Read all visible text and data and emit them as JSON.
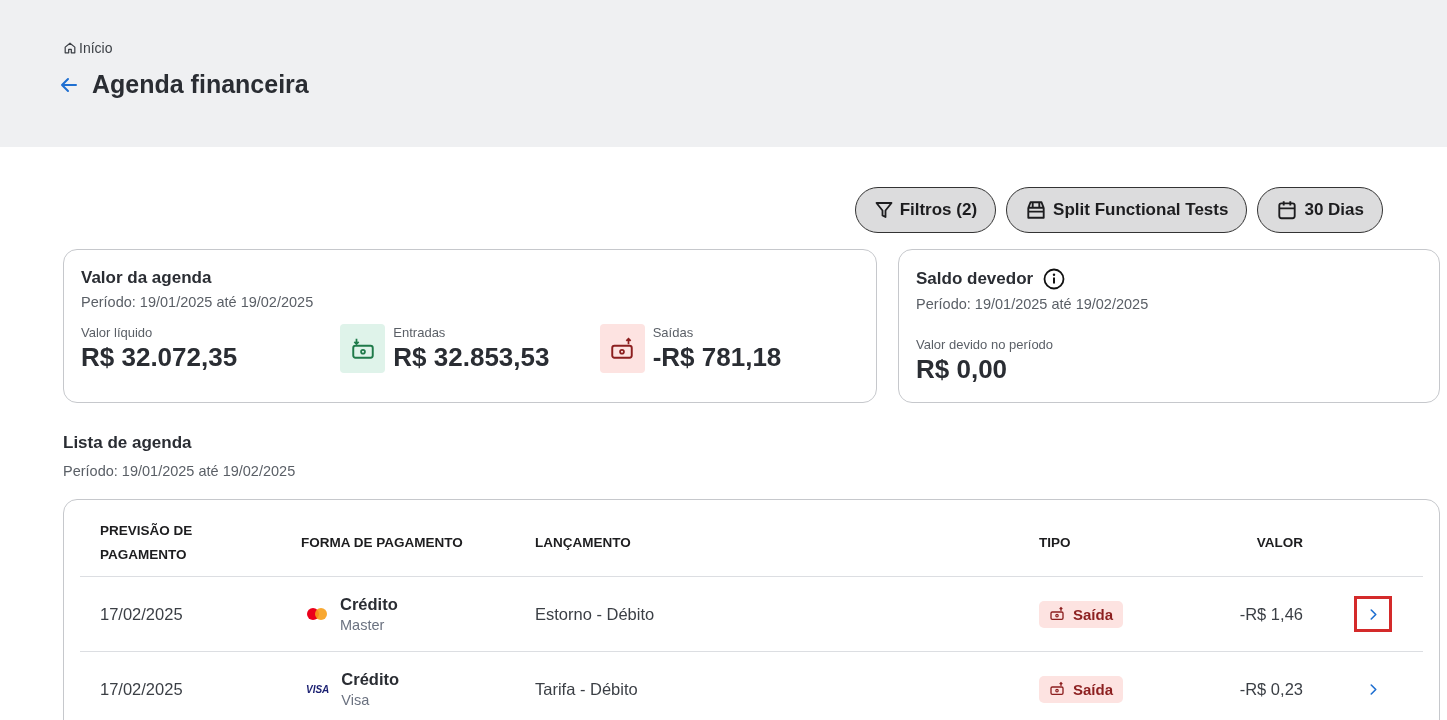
{
  "breadcrumb": {
    "label": "Início"
  },
  "page_title": "Agenda financeira",
  "toolbar": [
    {
      "kind": "filter",
      "label": "Filtros (2)"
    },
    {
      "kind": "store",
      "label": "Split Functional Tests"
    },
    {
      "kind": "calendar",
      "label": "30 Dias"
    }
  ],
  "summary_card": {
    "title": "Valor da agenda",
    "period": "Período: 19/01/2025 até 19/02/2025",
    "metrics": [
      {
        "kind": "net",
        "label": "Valor líquido",
        "value": "R$ 32.072,35"
      },
      {
        "kind": "in",
        "label": "Entradas",
        "value": "R$ 32.853,53"
      },
      {
        "kind": "out",
        "label": "Saídas",
        "value": "-R$ 781,18"
      }
    ]
  },
  "debt_card": {
    "title": "Saldo devedor",
    "period": "Período: 19/01/2025 até 19/02/2025",
    "label": "Valor devido no período",
    "value": "R$ 0,00"
  },
  "list": {
    "title": "Lista de agenda",
    "period": "Período: 19/01/2025 até 19/02/2025"
  },
  "table": {
    "columns": [
      "PREVISÃO DE PAGAMENTO",
      "FORMA DE PAGAMENTO",
      "LANÇAMENTO",
      "TIPO",
      "VALOR"
    ],
    "rows": [
      {
        "date": "17/02/2025",
        "method": "Crédito",
        "brand": {
          "kind": "mastercard",
          "name": "Master"
        },
        "entry": "Estorno - Débito",
        "type": {
          "kind": "out",
          "label": "Saída"
        },
        "amount": "-R$ 1,46",
        "highlighted": true
      },
      {
        "date": "17/02/2025",
        "method": "Crédito",
        "brand": {
          "kind": "visa",
          "logo": "VISA",
          "name": "Visa"
        },
        "entry": "Tarifa - Débito",
        "type": {
          "kind": "out",
          "label": "Saída"
        },
        "amount": "-R$ 0,23",
        "highlighted": false
      }
    ]
  }
}
